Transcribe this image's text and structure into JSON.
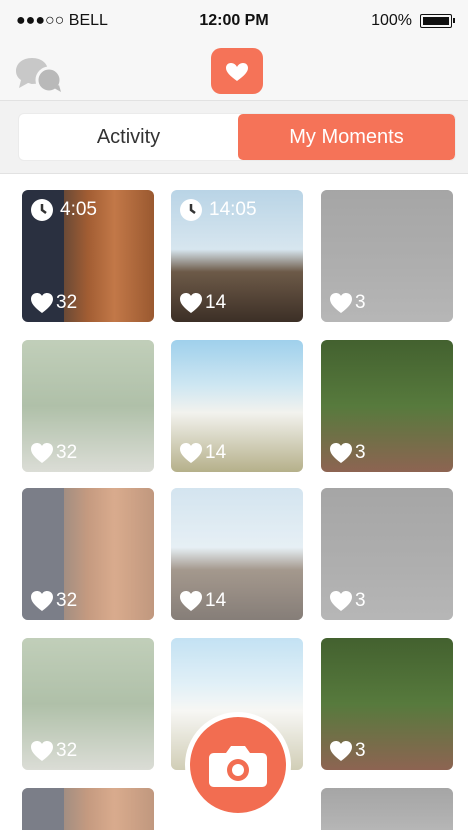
{
  "status_bar": {
    "carrier": "●●●○○ BELL",
    "time": "12:00 PM",
    "battery": "100%"
  },
  "nav": {
    "left_icon": "chat-bubbles-icon",
    "center_icon": "camera-heart-icon"
  },
  "segmented": {
    "tabs": [
      "Activity",
      "My Moments"
    ],
    "selected": "My Moments"
  },
  "colors": {
    "accent": "#f57358",
    "status_bg": "#f7f7f7",
    "segment_bg": "#f2f2f2"
  },
  "moments": [
    {
      "photo": "wood-interior",
      "likes": "32",
      "timer": "4:05"
    },
    {
      "photo": "building",
      "likes": "14",
      "timer": "14:05"
    },
    {
      "photo": "gas-station",
      "likes": "3"
    },
    {
      "photo": "forest-path",
      "likes": "32"
    },
    {
      "photo": "modern-house",
      "likes": "14"
    },
    {
      "photo": "dog-chair",
      "likes": "3"
    },
    {
      "photo": "wood-interior",
      "likes": "32"
    },
    {
      "photo": "building",
      "likes": "14"
    },
    {
      "photo": "gas-station",
      "likes": "3"
    },
    {
      "photo": "forest-path",
      "likes": "32"
    },
    {
      "photo": "modern-house",
      "likes": ""
    },
    {
      "photo": "dog-chair",
      "likes": "3"
    }
  ],
  "fab": {
    "icon": "camera-icon"
  }
}
